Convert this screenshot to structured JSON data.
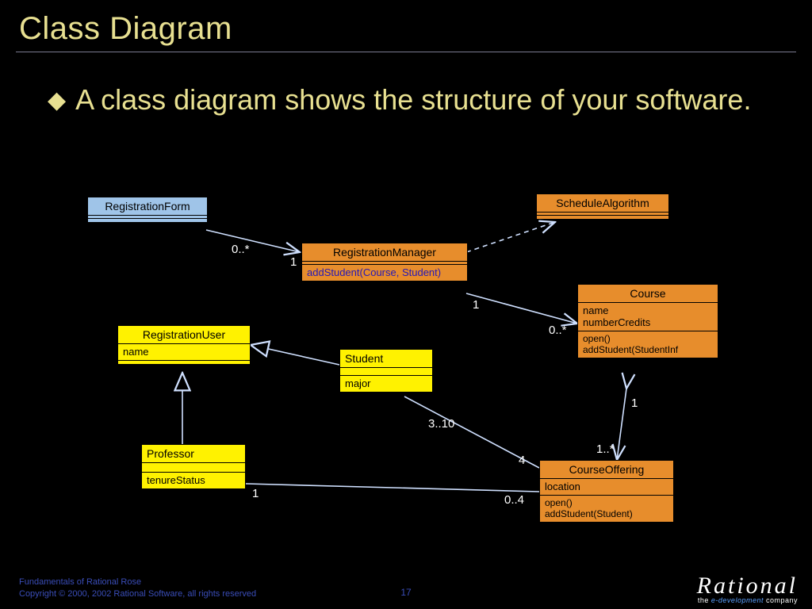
{
  "title": "Class Diagram",
  "bullet": "A class diagram shows the structure of your software.",
  "classes": {
    "registrationForm": {
      "name": "RegistrationForm"
    },
    "registrationManager": {
      "name": "RegistrationManager",
      "method": "addStudent(Course, Student)"
    },
    "scheduleAlgorithm": {
      "name": "ScheduleAlgorithm"
    },
    "registrationUser": {
      "name": "RegistrationUser",
      "attr": "name"
    },
    "student": {
      "name": "Student",
      "attr": "major"
    },
    "course": {
      "name": "Course",
      "attr1": "name",
      "attr2": "numberCredits",
      "op1": "open()",
      "op2": "addStudent(StudentInf"
    },
    "professor": {
      "name": "Professor",
      "attr": "tenureStatus"
    },
    "courseOffering": {
      "name": "CourseOffering",
      "attr": "location",
      "op1": "open()",
      "op2": "addStudent(Student)"
    }
  },
  "mult": {
    "rf_rm_from": "0..*",
    "rf_rm_to": "1",
    "rm_course_from": "1",
    "rm_course_to": "0..*",
    "student_co": "3..10",
    "co_student": "4",
    "prof_co_from": "1",
    "prof_co_to": "0..4",
    "course_co_from": "1",
    "course_co_to": "1..*"
  },
  "footer": {
    "line1": "Fundamentals of Rational Rose",
    "line2": "Copyright © 2000, 2002 Rational Software, all rights reserved",
    "page": "17"
  },
  "logo": {
    "brand": "Rational",
    "tag_pre": "the ",
    "tag_mid": "e-development",
    "tag_post": " company"
  }
}
